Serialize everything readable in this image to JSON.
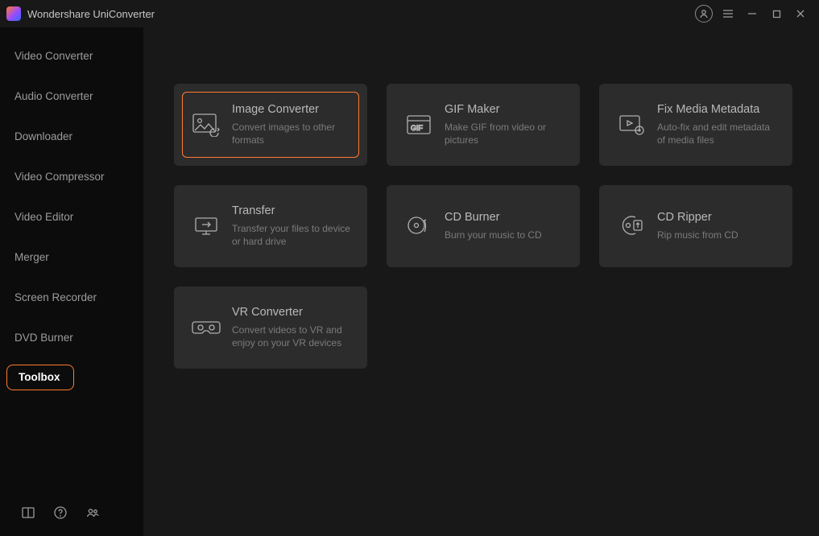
{
  "app": {
    "title": "Wondershare UniConverter"
  },
  "sidebar": {
    "items": [
      {
        "label": "Video Converter"
      },
      {
        "label": "Audio Converter"
      },
      {
        "label": "Downloader"
      },
      {
        "label": "Video Compressor"
      },
      {
        "label": "Video Editor"
      },
      {
        "label": "Merger"
      },
      {
        "label": "Screen Recorder"
      },
      {
        "label": "DVD Burner"
      },
      {
        "label": "Toolbox"
      }
    ],
    "active_index": 8
  },
  "tools": [
    {
      "title": "Image Converter",
      "desc": "Convert images to other formats",
      "icon": "image-icon",
      "highlighted": true
    },
    {
      "title": "GIF Maker",
      "desc": "Make GIF from video or pictures",
      "icon": "gif-icon",
      "highlighted": false
    },
    {
      "title": "Fix Media Metadata",
      "desc": "Auto-fix and edit metadata of media files",
      "icon": "metadata-icon",
      "highlighted": false
    },
    {
      "title": "Transfer",
      "desc": "Transfer your files to device or hard drive",
      "icon": "transfer-icon",
      "highlighted": false
    },
    {
      "title": "CD Burner",
      "desc": "Burn your music to CD",
      "icon": "cdburner-icon",
      "highlighted": false
    },
    {
      "title": "CD Ripper",
      "desc": "Rip music from CD",
      "icon": "cdripper-icon",
      "highlighted": false
    },
    {
      "title": "VR Converter",
      "desc": "Convert videos to VR and enjoy on your VR devices",
      "icon": "vr-icon",
      "highlighted": false
    }
  ],
  "colors": {
    "accent": "#ff7a2f",
    "card": "#2c2c2c",
    "sidebar": "#0c0c0c",
    "bg": "#181818"
  }
}
